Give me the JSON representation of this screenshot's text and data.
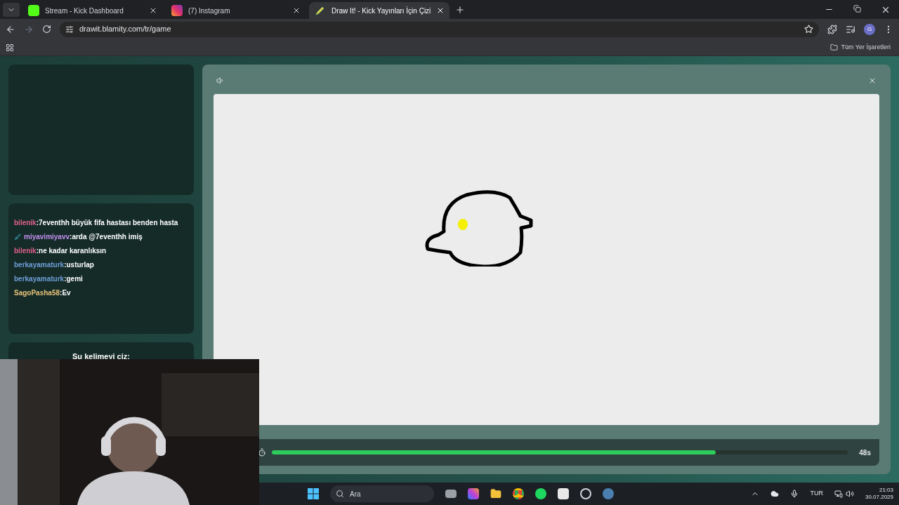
{
  "browser": {
    "tabs": [
      {
        "title": "Stream - Kick Dashboard",
        "selected": false
      },
      {
        "title": "(7) Instagram",
        "selected": false
      },
      {
        "title": "Draw It! - Kick Yayınları İçin Çizi",
        "selected": true
      }
    ],
    "url": "drawit.blamity.com/tr/game",
    "profile_initial": "G",
    "bookmarks_label": "Tüm Yer İşaretleri"
  },
  "chat": [
    {
      "user": "bilenik",
      "color": "#e0608a",
      "text": ":7eventhh büyük fifa hastası benden hasta",
      "badge": false
    },
    {
      "user": "miyavimiyavv",
      "color": "#c490f0",
      "text": ":arda @7eventhh imiş",
      "badge": true
    },
    {
      "user": "bilenik",
      "color": "#e0608a",
      "text": ":ne kadar karanlıksın",
      "badge": false
    },
    {
      "user": "berkayamaturk",
      "color": "#6f9fd8",
      "text": ":usturlap",
      "badge": false
    },
    {
      "user": "berkayamaturk",
      "color": "#6f9fd8",
      "text": ":gemi",
      "badge": false
    },
    {
      "user": "SagoPasha58",
      "color": "#e8c27a",
      "text": ":Ev",
      "badge": false
    }
  ],
  "word_prompt": "Şu kelimeyi çiz:",
  "timer": {
    "level": 0.77,
    "reading": "48s"
  },
  "taskbar": {
    "search_placeholder": "Ara",
    "language": "TUR",
    "time": "21:03",
    "date": "30.07.2025"
  }
}
